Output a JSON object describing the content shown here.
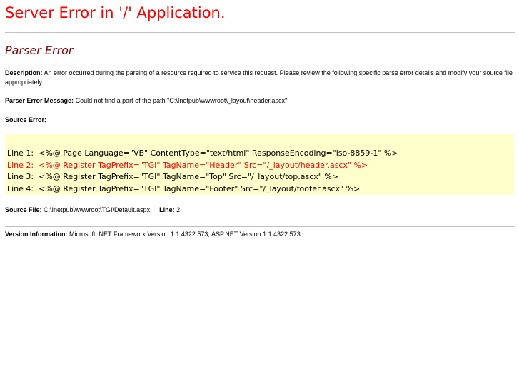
{
  "header": {
    "title": "Server Error in '/' Application.",
    "subtitle": "Parser Error"
  },
  "description": {
    "label": "Description:",
    "text": " An error occurred during the parsing of a resource required to service this request. Please review the following specific parse error details and modify your source file appropriately."
  },
  "parser_message": {
    "label": "Parser Error Message:",
    "text": " Could not find a part of the path \"C:\\Inetpub\\wwwroot\\_layout\\header.ascx\"."
  },
  "source_error": {
    "label": "Source Error:"
  },
  "code_lines": [
    {
      "text": "Line 1:  <%@ Page Language=\"VB\" ContentType=\"text/html\" ResponseEncoding=\"iso-8859-1\" %>",
      "is_error": false
    },
    {
      "text": "Line 2:  <%@ Register TagPrefix=\"TGI\" TagName=\"Header\" Src=\"/_layout/header.ascx\" %>",
      "is_error": true
    },
    {
      "text": "Line 3:  <%@ Register TagPrefix=\"TGI\" TagName=\"Top\" Src=\"/_layout/top.ascx\" %>",
      "is_error": false
    },
    {
      "text": "Line 4:  <%@ Register TagPrefix=\"TGI\" TagName=\"Footer\" Src=\"/_layout/footer.ascx\" %>",
      "is_error": false
    }
  ],
  "source_file": {
    "label": "Source File:",
    "path": " C:\\Inetpub\\wwwroot\\TGI\\Default.aspx",
    "line_label": "Line:",
    "line_value": " 2"
  },
  "version": {
    "label": "Version Information:",
    "text": " Microsoft .NET Framework Version:1.1.4322.573; ASP.NET Version:1.1.4322.573"
  },
  "colors": {
    "title": "#ff0000",
    "subtitle": "#800000",
    "code_background": "#ffffcc",
    "error_line": "#ff0000"
  }
}
